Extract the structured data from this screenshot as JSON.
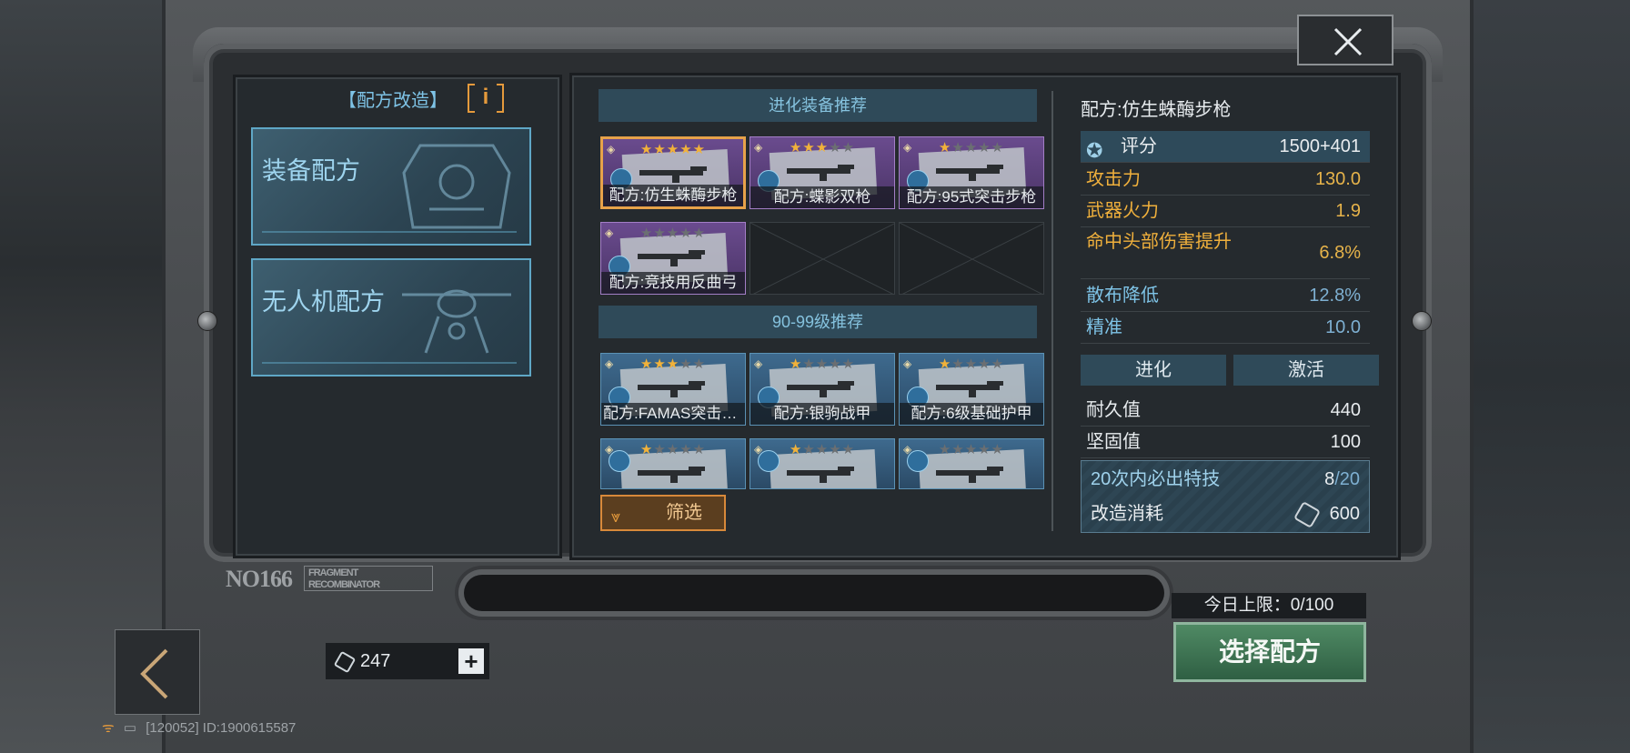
{
  "left_panel": {
    "title": "【配方改造】",
    "info_label": "i",
    "categories": [
      {
        "label": "装备配方"
      },
      {
        "label": "无人机配方"
      }
    ]
  },
  "sections": {
    "evolve_header": "进化装备推荐",
    "level_header": "90-99级推荐"
  },
  "evolve_items": [
    {
      "name": "配方:仿生蛛酶步枪",
      "stars": 5,
      "max_stars": 5,
      "quality": "gold"
    },
    {
      "name": "配方:蝶影双枪",
      "stars": 3,
      "max_stars": 5,
      "quality": "purple"
    },
    {
      "name": "配方:95式突击步枪",
      "stars": 1,
      "max_stars": 5,
      "quality": "purple"
    },
    {
      "name": "配方:竞技用反曲弓",
      "stars": 0,
      "max_stars": 5,
      "quality": "purple"
    }
  ],
  "level_items": [
    {
      "name": "配方:FAMAS突击步枪",
      "stars": 3,
      "max_stars": 5,
      "quality": "blue"
    },
    {
      "name": "配方:银驹战甲",
      "stars": 1,
      "max_stars": 5,
      "quality": "blue"
    },
    {
      "name": "配方:6级基础护甲",
      "stars": 1,
      "max_stars": 5,
      "quality": "blue"
    },
    {
      "name": "",
      "stars": 1,
      "max_stars": 5,
      "quality": "blue"
    },
    {
      "name": "",
      "stars": 1,
      "max_stars": 5,
      "quality": "blue"
    },
    {
      "name": "",
      "stars": 0,
      "max_stars": 5,
      "quality": "blue"
    }
  ],
  "filter_label": "筛选",
  "details": {
    "title": "配方:仿生蛛酶步枪",
    "rating_label": "评分",
    "rating_value": "1500+401",
    "stats": [
      {
        "label": "攻击力",
        "value": "130.0"
      },
      {
        "label": "武器火力",
        "value": "1.9"
      },
      {
        "label": "命中头部伤害提升",
        "value": "6.8%"
      },
      {
        "label": "散布降低",
        "value": "12.8%"
      },
      {
        "label": "精准",
        "value": "10.0"
      }
    ],
    "tabs": [
      "进化",
      "激活"
    ],
    "durability_label": "耐久值",
    "durability_value": "440",
    "sturdiness_label": "坚固值",
    "sturdiness_value": "100",
    "special_label": "20次内必出特技",
    "special_current": "8",
    "special_total": "/20",
    "cost_label": "改造消耗",
    "cost_value": "600"
  },
  "bottom": {
    "nameplate_main": "NO166",
    "nameplate_sub": "FRAGMENT RECOMBINATOR",
    "daily_limit": "今日上限：0/100",
    "select_button": "选择配方",
    "currency_amount": "247",
    "plus_label": "+",
    "status_text": "[120052] ID:1900615587"
  },
  "colors": {
    "gold_text": "#f0b03c",
    "blue_text": "#7ec3e6",
    "accent_orange": "#e59a3c",
    "confirm_green": "#3f7553"
  }
}
